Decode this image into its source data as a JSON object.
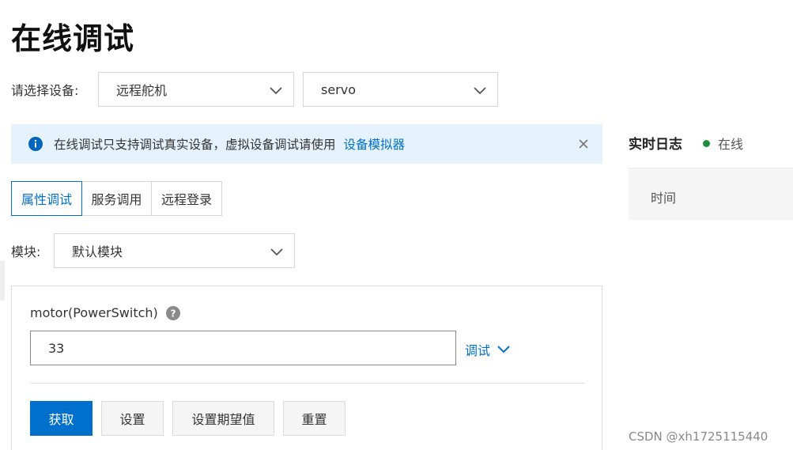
{
  "page": {
    "title": "在线调试"
  },
  "device_select": {
    "label": "请选择设备:",
    "product_value": "远程舵机",
    "device_value": "servo"
  },
  "notice": {
    "text": "在线调试只支持调试真实设备，虚拟设备调试请使用",
    "link": "设备模拟器"
  },
  "tabs": [
    {
      "label": "属性调试",
      "active": true
    },
    {
      "label": "服务调用",
      "active": false
    },
    {
      "label": "远程登录",
      "active": false
    }
  ],
  "module": {
    "label": "模块:",
    "value": "默认模块"
  },
  "property": {
    "name": "motor(PowerSwitch)",
    "value": "33",
    "debug_label": "调试"
  },
  "buttons": {
    "get": "获取",
    "set": "设置",
    "set_expected": "设置期望值",
    "reset": "重置"
  },
  "log": {
    "title": "实时日志",
    "status": "在线",
    "status_color": "#1e8e3e",
    "column_time": "时间"
  },
  "watermark": "CSDN @xh1725115440",
  "colors": {
    "accent": "#0070cc",
    "notice_bg": "#e6f2fb"
  }
}
